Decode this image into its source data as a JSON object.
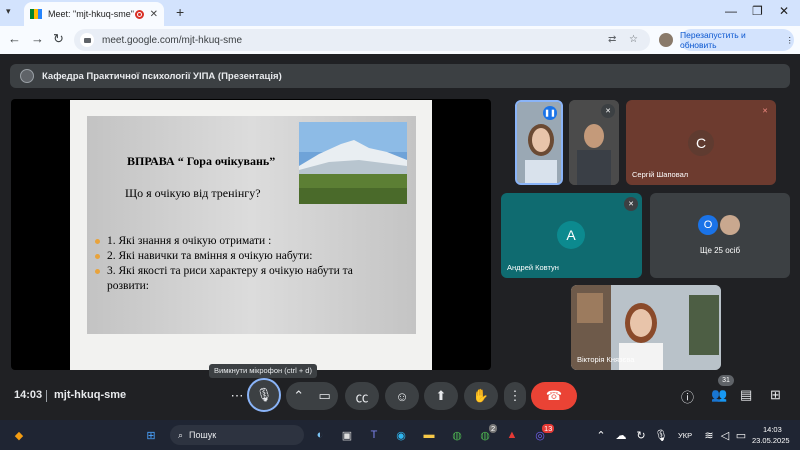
{
  "browser": {
    "tab_title": "Meet: \"mjt-hkuq-sme\"",
    "url": "meet.google.com/mjt-hkuq-sme",
    "restart_label": "Перезапустить и обновить"
  },
  "meet": {
    "presentation_owner": "Кафедра Практичної психології УІПА (Презентація)",
    "slide": {
      "title": "ВПРАВА “ Гора очікувань”",
      "subtitle": "Що я очікую від тренінгу?",
      "items": [
        "1. Які знання я очікую отримати :",
        "2. Які навички та вміння я очікую набути:",
        "3. Які якості та риси характеру я очікую набути та розвити:"
      ]
    },
    "participants": [
      {
        "name": "Сергій Шаповал",
        "initial": "С",
        "color": "#6d3b2f"
      },
      {
        "name": "Андрей Ковтун",
        "initial": "А",
        "color": "#0f6b70"
      },
      {
        "name": "Вікторія Князєва"
      }
    ],
    "others": {
      "label": "Ще 25 осіб",
      "initial": "О"
    },
    "tooltip": "Вимкнути мікрофон (ctrl + d)",
    "time": "14:03",
    "meeting_code": "mjt-hkuq-sme",
    "participant_count": "31"
  },
  "taskbar": {
    "search_placeholder": "Пошук",
    "lang": "УКР",
    "clock_time": "14:03",
    "clock_date": "23.05.2025",
    "chrome_badge": "2",
    "viber_badge": "13"
  }
}
